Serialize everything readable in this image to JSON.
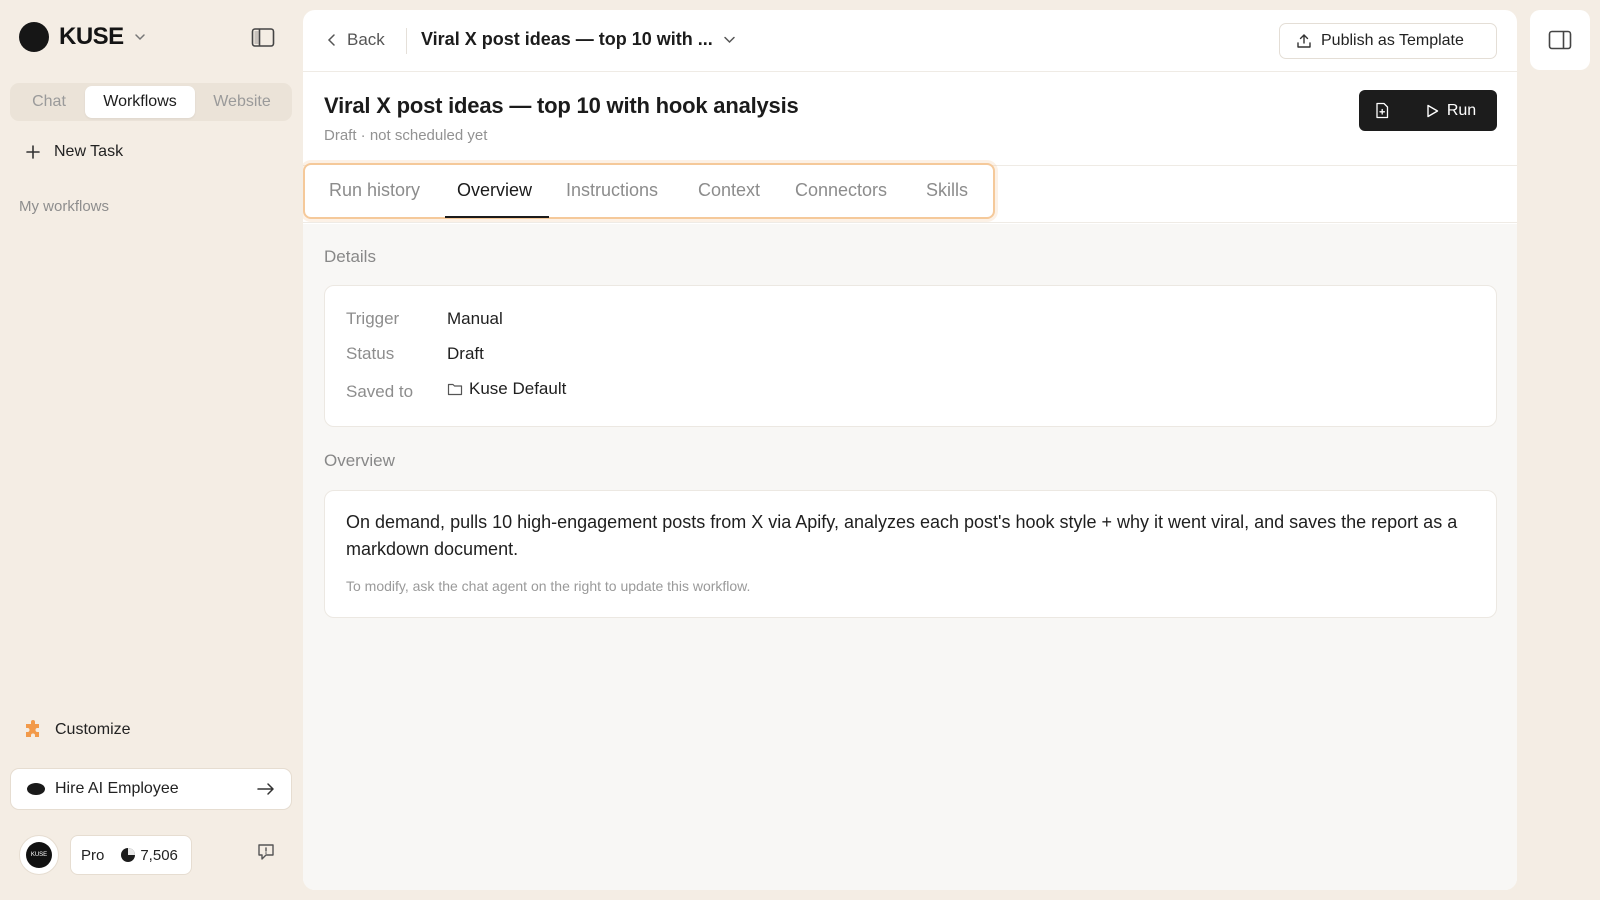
{
  "brand": {
    "name": "KUSE"
  },
  "sidebar": {
    "mode_tabs": [
      {
        "label": "Chat",
        "active": false
      },
      {
        "label": "Workflows",
        "active": true
      },
      {
        "label": "Website",
        "active": false
      }
    ],
    "new_task_label": "New Task",
    "section_label": "My workflows",
    "customize_label": "Customize",
    "hire_label": "Hire AI Employee",
    "avatar_text": "KUSE",
    "plan": "Pro",
    "credits": "7,506"
  },
  "topbar": {
    "back_label": "Back",
    "breadcrumb_title": "Viral X post ideas — top 10 with ...",
    "publish_label": "Publish as Template"
  },
  "page": {
    "title": "Viral X post ideas — top 10 with hook analysis",
    "subtitle": "Draft · not scheduled yet",
    "run_label": "Run"
  },
  "tabs": [
    {
      "label": "Run history",
      "active": false
    },
    {
      "label": "Overview",
      "active": true
    },
    {
      "label": "Instructions",
      "active": false
    },
    {
      "label": "Context",
      "active": false
    },
    {
      "label": "Connectors",
      "active": false
    },
    {
      "label": "Skills",
      "active": false
    }
  ],
  "details": {
    "section_label": "Details",
    "rows": [
      {
        "key": "Trigger",
        "value": "Manual"
      },
      {
        "key": "Status",
        "value": "Draft"
      },
      {
        "key": "Saved to",
        "value": "Kuse Default"
      }
    ]
  },
  "overview": {
    "section_label": "Overview",
    "text": "On demand, pulls 10 high-engagement posts from X via Apify, analyzes each post's hook style + why it went viral, and saves the report as a markdown document.",
    "hint": "To modify, ask the chat agent on the right to update this workflow."
  },
  "colors": {
    "app_bg": "#f4ede4",
    "accent_highlight": "#f5c99a",
    "primary_button": "#1c1c1c",
    "customize_icon": "#f29a4a"
  }
}
